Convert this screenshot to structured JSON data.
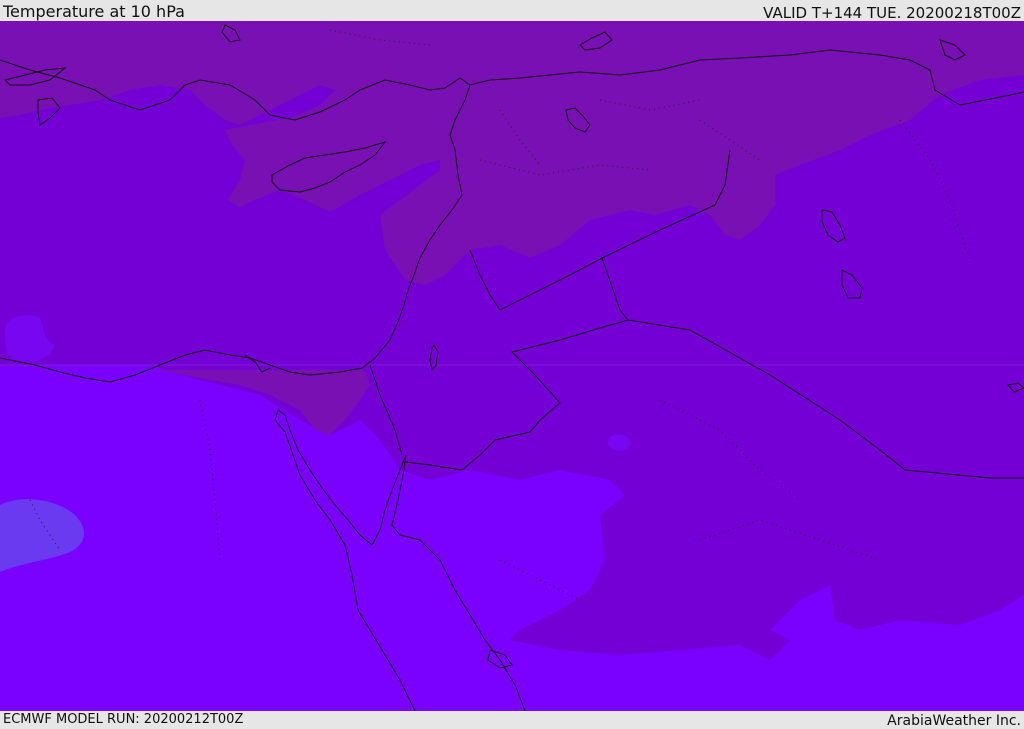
{
  "header": {
    "title": "Temperature at 10 hPa",
    "valid": "VALID T+144 TUE. 20200218T00Z"
  },
  "footer": {
    "model_run": "ECMWF MODEL RUN: 20200212T00Z",
    "credit": "ArabiaWeather Inc."
  },
  "map": {
    "region": "Eastern Mediterranean and Middle East",
    "colors": {
      "warmest_band": "#7810b4",
      "mid_band": "#7200d2",
      "mid_cool_band": "#7806f0",
      "cool_band": "#7a00ff",
      "coolest_patch": "#6a3af0",
      "coastline": "#111111"
    }
  }
}
